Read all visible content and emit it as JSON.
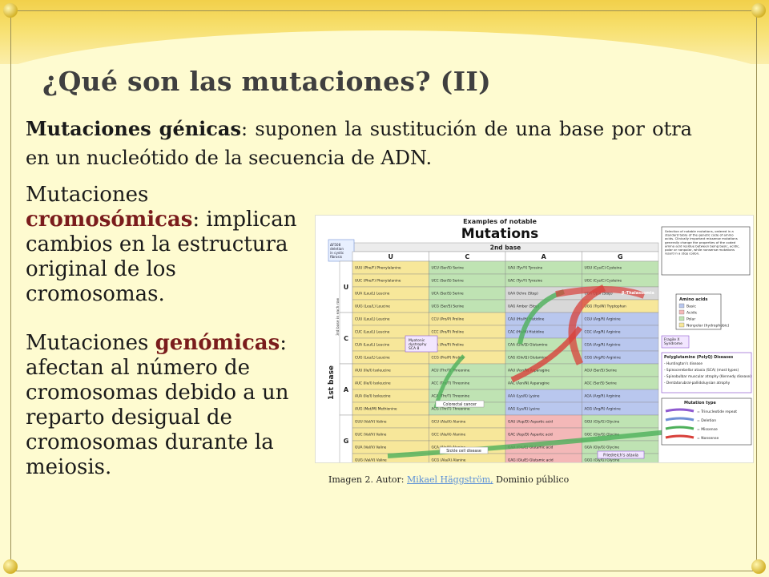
{
  "slide": {
    "title": "¿Qué son las mutaciones? (II)",
    "gene": {
      "term": "Mutaciones génicas",
      "text": ": suponen la sustitución de una base por otra en un nucleótido de la secuencia de ADN."
    },
    "chromo": {
      "prefix": "Mutaciones ",
      "term": "cromosómicas",
      "text": ": implican cambios en la estructura original de los cromosomas."
    },
    "genomic": {
      "prefix": "Mutaciones ",
      "term": "genómicas",
      "text": ": afectan al número de cromosomas debido a un reparto desigual de cromosomas durante la meiosis."
    }
  },
  "figure": {
    "header_small": "Examples of notable",
    "header_big": "Mutations",
    "second_base": "2nd base",
    "first_base": "1st base",
    "third_base": "3rd base in each row",
    "bases": [
      "U",
      "C",
      "A",
      "G"
    ],
    "deletion_note": "ΔF508 deletion in cystic fibrosis",
    "info_box": "Selection of notable mutations, ordered in a standard table of the genetic code of amino acids. Clinically important missense mutations generally change the properties of the coded amino acid residue between being basic, acidic, polar or nonpolar, while nonsense mutations result in a stop codon.",
    "legend_aa_title": "Amino acids",
    "legend_aa": [
      "Basic",
      "Acidic",
      "Polar",
      "Nonpolar (hydrophobic)"
    ],
    "legend_aa_colors": [
      "#b9c7ee",
      "#f4b8b8",
      "#bfe3b3",
      "#f7e79a"
    ],
    "fragile_x": "Fragile X Syndrome",
    "polyq_title": "Polyglutamine (PolyQ) Diseases",
    "polyq": [
      "- Huntington's disease",
      "- Spinocerebellar ataxia (SCA) (most types)",
      "- Spinobulbar muscular atrophy (Kennedy disease)",
      "- Dentatorubral-pallidoluysian atrophy"
    ],
    "mutation_type_title": "Mutation type",
    "mutation_types": [
      "Trinucleotide repeat",
      "Deletion",
      "Missense",
      "Nonsense"
    ],
    "myotonic": "Myotonic dystrophy SCA 8",
    "colorectal": "Colorectal cancer",
    "sickle": "Sickle cell disease",
    "friedreich": "Friedreich's ataxia",
    "beta_thal": "β-Thalassemia",
    "codons": {
      "U": [
        [
          "UUU (Phe/F) Phenylalanine",
          "UCU (Ser/S) Serine",
          "UAU (Tyr/Y) Tyrosine",
          "UGU (Cys/C) Cysteine"
        ],
        [
          "UUC (Phe/F) Phenylalanine",
          "UCC (Ser/S) Serine",
          "UAC (Tyr/Y) Tyrosine",
          "UGC (Cys/C) Cysteine"
        ],
        [
          "UUA (Leu/L) Leucine",
          "UCA (Ser/S) Serine",
          "UAA Ochre (Stop)",
          "UGA Opal (Stop)"
        ],
        [
          "UUG (Leu/L) Leucine",
          "UCG (Ser/S) Serine",
          "UAG Amber (Stop)",
          "UGG (Trp/W) Tryptophan"
        ]
      ],
      "C": [
        [
          "CUU (Leu/L) Leucine",
          "CCU (Pro/P) Proline",
          "CAU (His/H) Histidine",
          "CGU (Arg/R) Arginine"
        ],
        [
          "CUC (Leu/L) Leucine",
          "CCC (Pro/P) Proline",
          "CAC (His/H) Histidine",
          "CGC (Arg/R) Arginine"
        ],
        [
          "CUA (Leu/L) Leucine",
          "CCA (Pro/P) Proline",
          "CAA (Gln/Q) Glutamine",
          "CGA (Arg/R) Arginine"
        ],
        [
          "CUG (Leu/L) Leucine",
          "CCG (Pro/P) Proline",
          "CAG (Gln/Q) Glutamine",
          "CGG (Arg/R) Arginine"
        ]
      ],
      "A": [
        [
          "AUU (Ile/I) Isoleucine",
          "ACU (Thr/T) Threonine",
          "AAU (Asn/N) Asparagine",
          "AGU (Ser/S) Serine"
        ],
        [
          "AUC (Ile/I) Isoleucine",
          "ACC (Thr/T) Threonine",
          "AAC (Asn/N) Asparagine",
          "AGC (Ser/S) Serine"
        ],
        [
          "AUA (Ile/I) Isoleucine",
          "ACA (Thr/T) Threonine",
          "AAA (Lys/K) Lysine",
          "AGA (Arg/R) Arginine"
        ],
        [
          "AUG (Met/M) Methionine",
          "ACG (Thr/T) Threonine",
          "AAG (Lys/K) Lysine",
          "AGG (Arg/R) Arginine"
        ]
      ],
      "G": [
        [
          "GUU (Val/V) Valine",
          "GCU (Ala/A) Alanine",
          "GAU (Asp/D) Aspartic acid",
          "GGU (Gly/G) Glycine"
        ],
        [
          "GUC (Val/V) Valine",
          "GCC (Ala/A) Alanine",
          "GAC (Asp/D) Aspartic acid",
          "GGC (Gly/G) Glycine"
        ],
        [
          "GUA (Val/V) Valine",
          "GCA (Ala/A) Alanine",
          "GAA (Glu/E) Glutamic acid",
          "GGA (Gly/G) Glycine"
        ],
        [
          "GUG (Val/V) Valine",
          "GCG (Ala/A) Alanine",
          "GAG (Glu/E) Glutamic acid",
          "GGG (Gly/G) Glycine"
        ]
      ]
    },
    "cell_colors": {
      "U": [
        [
          "#f7e79a",
          "#bfe3b3",
          "#bfe3b3",
          "#bfe3b3"
        ],
        [
          "#f7e79a",
          "#bfe3b3",
          "#bfe3b3",
          "#bfe3b3"
        ],
        [
          "#f7e79a",
          "#bfe3b3",
          "#d8d8d8",
          "#d8d8d8"
        ],
        [
          "#f7e79a",
          "#bfe3b3",
          "#d8d8d8",
          "#f7e79a"
        ]
      ],
      "C": [
        [
          "#f7e79a",
          "#f7e79a",
          "#b9c7ee",
          "#b9c7ee"
        ],
        [
          "#f7e79a",
          "#f7e79a",
          "#b9c7ee",
          "#b9c7ee"
        ],
        [
          "#f7e79a",
          "#f7e79a",
          "#bfe3b3",
          "#b9c7ee"
        ],
        [
          "#f7e79a",
          "#f7e79a",
          "#bfe3b3",
          "#b9c7ee"
        ]
      ],
      "A": [
        [
          "#f7e79a",
          "#bfe3b3",
          "#bfe3b3",
          "#bfe3b3"
        ],
        [
          "#f7e79a",
          "#bfe3b3",
          "#bfe3b3",
          "#bfe3b3"
        ],
        [
          "#f7e79a",
          "#bfe3b3",
          "#b9c7ee",
          "#b9c7ee"
        ],
        [
          "#f7e79a",
          "#bfe3b3",
          "#b9c7ee",
          "#b9c7ee"
        ]
      ],
      "G": [
        [
          "#f7e79a",
          "#f7e79a",
          "#f4b8b8",
          "#bfe3b3"
        ],
        [
          "#f7e79a",
          "#f7e79a",
          "#f4b8b8",
          "#bfe3b3"
        ],
        [
          "#f7e79a",
          "#f7e79a",
          "#f4b8b8",
          "#bfe3b3"
        ],
        [
          "#f7e79a",
          "#f7e79a",
          "#f4b8b8",
          "#bfe3b3"
        ]
      ]
    }
  },
  "caption": {
    "prefix": "Imagen 2. Autor: ",
    "link": "Mikael Häggström,",
    "suffix": " Dominio público"
  }
}
